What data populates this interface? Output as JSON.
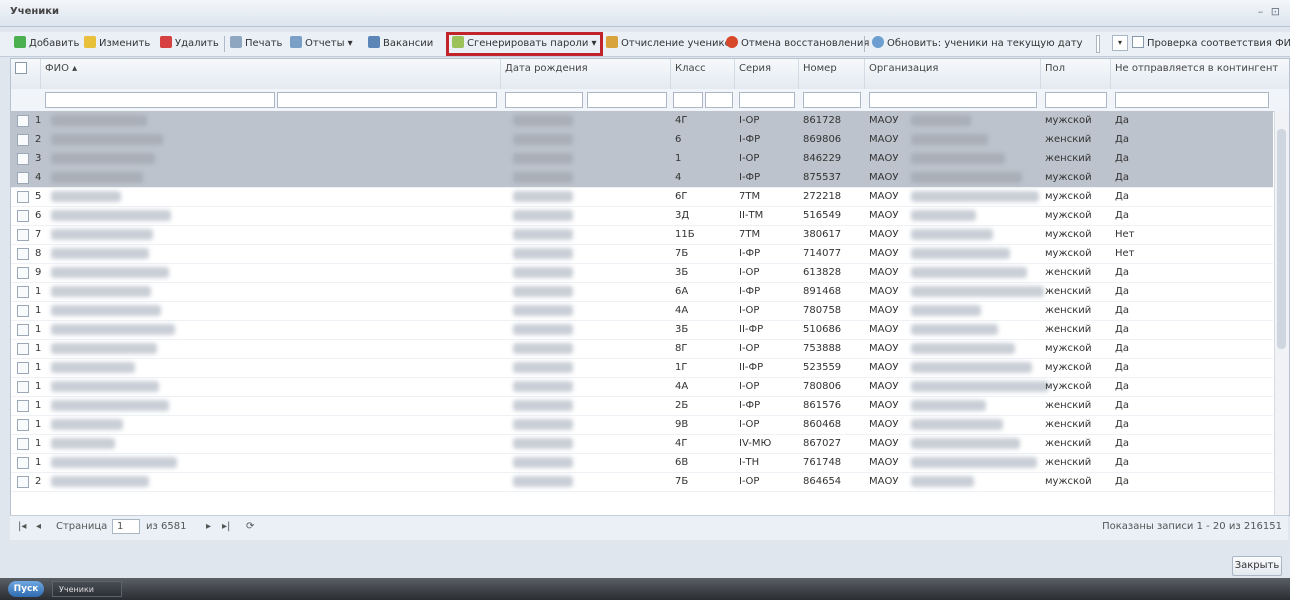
{
  "window": {
    "title": "Ученики"
  },
  "toolbar": {
    "add": "Добавить",
    "edit": "Изменить",
    "delete": "Удалить",
    "print": "Печать",
    "reports": "Отчеты",
    "vacancies": "Вакансии",
    "generate_passwords": "Сгенерировать пароли",
    "expulsion": "Отчисление учеников",
    "cancel_restore": "Отмена восстановления",
    "refresh_label": "Обновить: ученики на текущую дату",
    "check_fio": "Проверка соответствия ФИО"
  },
  "columns": [
    {
      "key": "fio",
      "label": "ФИО"
    },
    {
      "key": "birth",
      "label": "Дата рождения"
    },
    {
      "key": "class",
      "label": "Класс"
    },
    {
      "key": "series",
      "label": "Серия"
    },
    {
      "key": "number",
      "label": "Номер"
    },
    {
      "key": "org",
      "label": "Организация"
    },
    {
      "key": "gender",
      "label": "Пол"
    },
    {
      "key": "contingent",
      "label": "Не отправляется в контингент"
    }
  ],
  "rows": [
    {
      "n": "1",
      "class": "4Г",
      "series": "I-ОР",
      "number": "861728",
      "org": "МАОУ",
      "gender": "мужской",
      "contingent": "Да",
      "selected": true
    },
    {
      "n": "2",
      "class": "6",
      "series": "I-ФР",
      "number": "869806",
      "org": "МАОУ",
      "gender": "женский",
      "contingent": "Да",
      "selected": true
    },
    {
      "n": "3",
      "class": "1",
      "series": "I-ОР",
      "number": "846229",
      "org": "МАОУ",
      "gender": "женский",
      "contingent": "Да",
      "selected": true
    },
    {
      "n": "4",
      "class": "4",
      "series": "I-ФР",
      "number": "875537",
      "org": "МАОУ",
      "gender": "мужской",
      "contingent": "Да",
      "selected": true
    },
    {
      "n": "5",
      "class": "6Г",
      "series": "7ТМ",
      "number": "272218",
      "org": "МАОУ",
      "gender": "мужской",
      "contingent": "Да",
      "selected": false
    },
    {
      "n": "6",
      "class": "3Д",
      "series": "II-ТМ",
      "number": "516549",
      "org": "МАОУ",
      "gender": "мужской",
      "contingent": "Да",
      "selected": false
    },
    {
      "n": "7",
      "class": "11Б",
      "series": "7ТМ",
      "number": "380617",
      "org": "МАОУ",
      "gender": "мужской",
      "contingent": "Нет",
      "selected": false
    },
    {
      "n": "8",
      "class": "7Б",
      "series": "I-ФР",
      "number": "714077",
      "org": "МАОУ",
      "gender": "мужской",
      "contingent": "Нет",
      "selected": false
    },
    {
      "n": "9",
      "class": "3Б",
      "series": "I-ОР",
      "number": "613828",
      "org": "МАОУ",
      "gender": "женский",
      "contingent": "Да",
      "selected": false
    },
    {
      "n": "1",
      "class": "6А",
      "series": "I-ФР",
      "number": "891468",
      "org": "МАОУ",
      "gender": "женский",
      "contingent": "Да",
      "selected": false
    },
    {
      "n": "1",
      "class": "4А",
      "series": "I-ОР",
      "number": "780758",
      "org": "МАОУ",
      "gender": "женский",
      "contingent": "Да",
      "selected": false
    },
    {
      "n": "1",
      "class": "3Б",
      "series": "II-ФР",
      "number": "510686",
      "org": "МАОУ",
      "gender": "женский",
      "contingent": "Да",
      "selected": false
    },
    {
      "n": "1",
      "class": "8Г",
      "series": "I-ОР",
      "number": "753888",
      "org": "МАОУ",
      "gender": "мужской",
      "contingent": "Да",
      "selected": false
    },
    {
      "n": "1",
      "class": "1Г",
      "series": "II-ФР",
      "number": "523559",
      "org": "МАОУ",
      "gender": "мужской",
      "contingent": "Да",
      "selected": false
    },
    {
      "n": "1",
      "class": "4А",
      "series": "I-ОР",
      "number": "780806",
      "org": "МАОУ",
      "gender": "мужской",
      "contingent": "Да",
      "selected": false
    },
    {
      "n": "1",
      "class": "2Б",
      "series": "I-ФР",
      "number": "861576",
      "org": "МАОУ",
      "gender": "женский",
      "contingent": "Да",
      "selected": false
    },
    {
      "n": "1",
      "class": "9В",
      "series": "I-ОР",
      "number": "860468",
      "org": "МАОУ",
      "gender": "женский",
      "contingent": "Да",
      "selected": false
    },
    {
      "n": "1",
      "class": "4Г",
      "series": "IV-МЮ",
      "number": "867027",
      "org": "МАОУ",
      "gender": "женский",
      "contingent": "Да",
      "selected": false
    },
    {
      "n": "1",
      "class": "6В",
      "series": "I-ТН",
      "number": "761748",
      "org": "МАОУ",
      "gender": "женский",
      "contingent": "Да",
      "selected": false
    },
    {
      "n": "2",
      "class": "7Б",
      "series": "I-ОР",
      "number": "864654",
      "org": "МАОУ",
      "gender": "мужской",
      "contingent": "Да",
      "selected": false
    }
  ],
  "pager": {
    "page_label": "Страница",
    "page_value": "1",
    "of_label": "из 6581",
    "summary": "Показаны записи 1 - 20 из 216151"
  },
  "footer": {
    "close": "Закрыть"
  },
  "taskbar": {
    "start": "Пуск",
    "task": "Ученики"
  }
}
